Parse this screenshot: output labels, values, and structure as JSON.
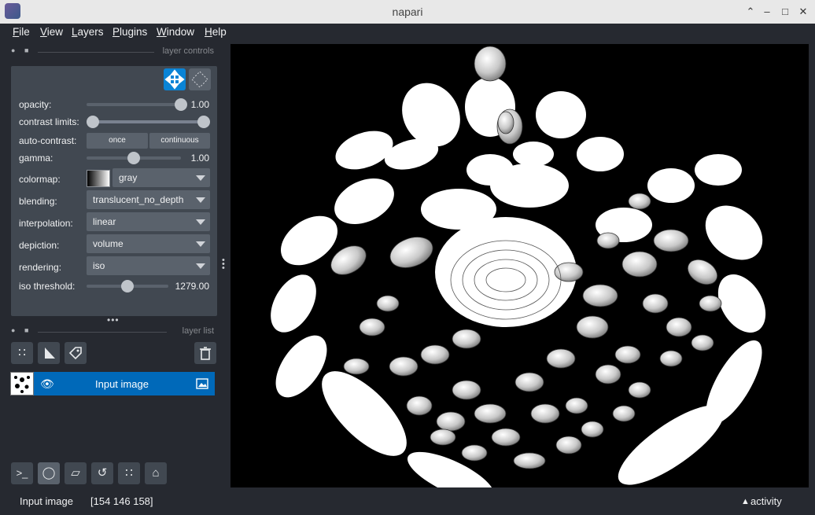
{
  "window": {
    "title": "napari"
  },
  "menu": [
    "File",
    "View",
    "Layers",
    "Plugins",
    "Window",
    "Help"
  ],
  "controls_header": "layer controls",
  "layerlist_header": "layer list",
  "controls": {
    "opacity": {
      "label": "opacity:",
      "value": "1.00",
      "fraction": 1.0
    },
    "contrast": {
      "label": "contrast limits:"
    },
    "auto_contrast": {
      "label": "auto-contrast:",
      "once": "once",
      "continuous": "continuous"
    },
    "gamma": {
      "label": "gamma:",
      "value": "1.00",
      "fraction": 0.5
    },
    "colormap": {
      "label": "colormap:",
      "value": "gray"
    },
    "blending": {
      "label": "blending:",
      "value": "translucent_no_depth"
    },
    "interpolation": {
      "label": "interpolation:",
      "value": "linear"
    },
    "depiction": {
      "label": "depiction:",
      "value": "volume"
    },
    "rendering": {
      "label": "rendering:",
      "value": "iso"
    },
    "iso_threshold": {
      "label": "iso threshold:",
      "value": "1279.00",
      "fraction": 0.5
    }
  },
  "layers": [
    {
      "name": "Input image"
    }
  ],
  "status": {
    "layer": "Input image",
    "coords": "[154 146 158]",
    "activity": "activity"
  }
}
